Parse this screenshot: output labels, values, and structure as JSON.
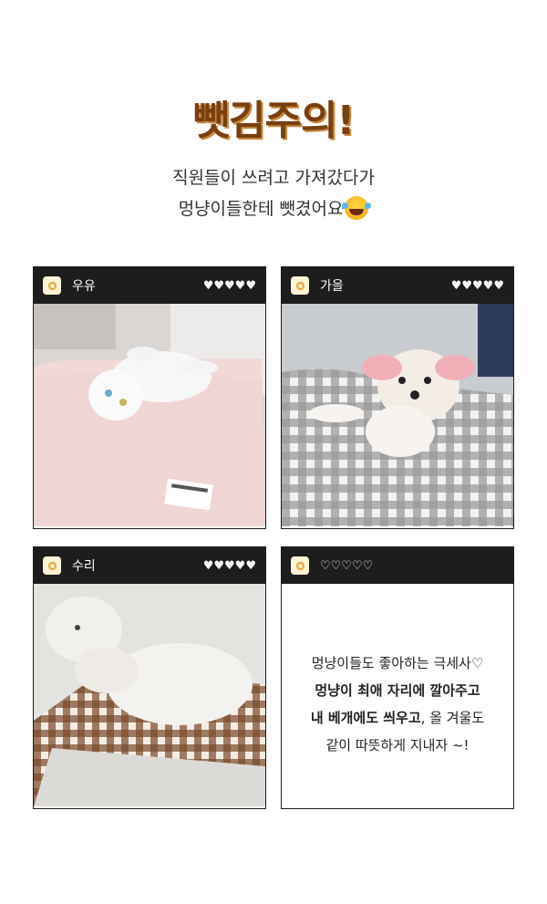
{
  "header": {
    "title": "뺏김주의!",
    "subtitle_line1": "직원들이 쓰려고 가져갔다가",
    "subtitle_line2": "멍냥이들한테 뺏겼어요",
    "emoji": "laughing-tears-emoji"
  },
  "cards": [
    {
      "name": "우유",
      "hearts": "♥♥♥♥♥",
      "photo": "white cat lying on pink blanket"
    },
    {
      "name": "가을",
      "hearts": "♥♥♥♥♥",
      "photo": "white puppy on gray gingham blanket"
    },
    {
      "name": "수리",
      "hearts": "♥♥♥♥♥",
      "photo": "white poodle on brown gingham blanket"
    },
    {
      "name": "",
      "hearts": "♡♡♡♡♡",
      "text_line1": "멍냥이들도 좋아하는 극세사♡",
      "text_line2_bold": "멍냥이 최애 자리에 깔아주고",
      "text_line3_bold": "내 베개에도 씌우고",
      "text_line3_rest": ", 올 겨울도",
      "text_line4": "같이 따뜻하게 지내자 ~!"
    }
  ],
  "colors": {
    "title": "#7a3f10",
    "title_shadow": "#c98a3c",
    "card_header": "#1d1d1d",
    "camera_icon": "#e8a531"
  }
}
